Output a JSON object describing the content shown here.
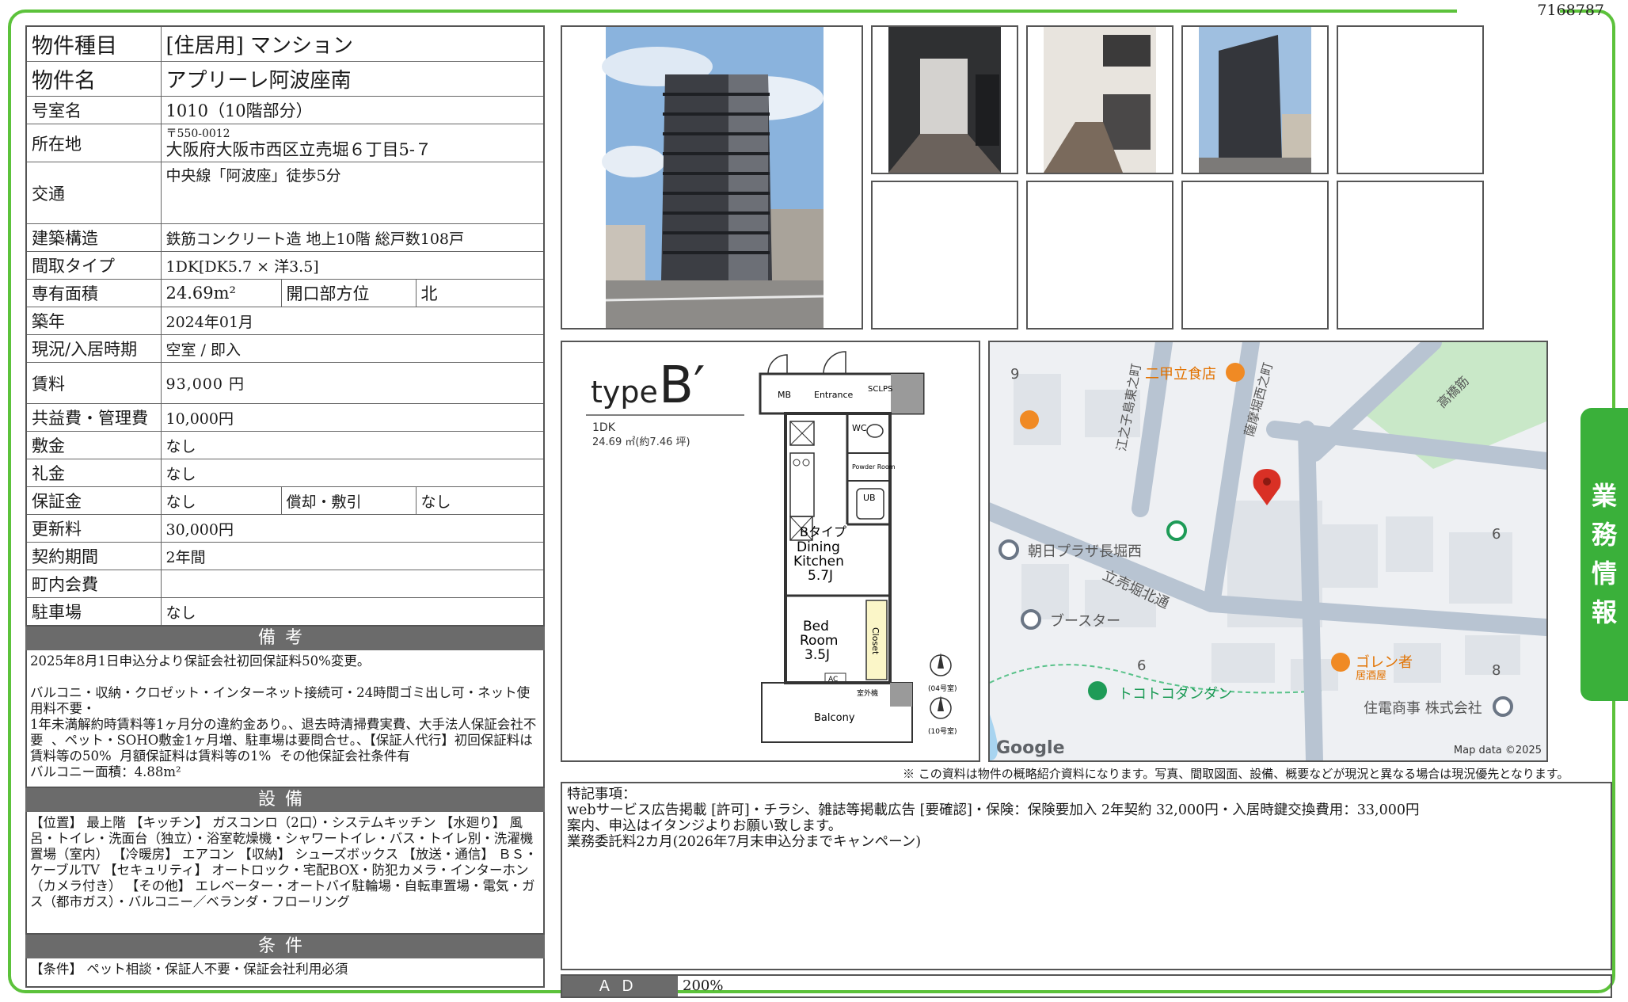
{
  "doc_id": "7168787",
  "side_tab": [
    "業",
    "務",
    "情",
    "報"
  ],
  "property": {
    "type_label": "物件種目",
    "type_value": "[住居用]  マンション",
    "name_label": "物件名",
    "name_value": "アプリーレ阿波座南",
    "room_label": "号室名",
    "room_value": "1010（10階部分）",
    "address_label": "所在地",
    "postal": "〒550-0012",
    "address": "大阪府大阪市西区立売堀６丁目5-７",
    "transport_label": "交通",
    "transport_value": "中央線「阿波座」徒歩5分",
    "structure_label": "建築構造",
    "structure_value": "鉄筋コンクリート造  地上10階  総戸数108戸",
    "layout_label": "間取タイプ",
    "layout_value": "1DK[DK5.7 × 洋3.5]",
    "area_label": "専有面積",
    "area_value": "24.69m²",
    "direction_label": "開口部方位",
    "direction_value": "北",
    "built_label": "築年",
    "built_value": "2024年01月",
    "status_label": "現況/入居時期",
    "status_value": "空室 /  即入",
    "rent_label": "賃料",
    "rent_value": "93,000 円",
    "fee_label": "共益費・管理費",
    "fee_value": "10,000円",
    "deposit_label": "敷金",
    "deposit_value": "なし",
    "key_money_label": "礼金",
    "key_money_value": "なし",
    "guarantee_label": "保証金",
    "guarantee_value": "なし",
    "amort_label": "償却・敷引",
    "amort_value": "なし",
    "renewal_label": "更新料",
    "renewal_value": "30,000円",
    "contract_label": "契約期間",
    "contract_value": "2年間",
    "town_fee_label": "町内会費",
    "town_fee_value": "",
    "parking_label": "駐車場",
    "parking_value": "なし"
  },
  "remarks_section": {
    "title": "備考",
    "text": "2025年8月1日申込分より保証会社初回保証料50%変更。\n\nバルコニ・収納・クロゼット・インターネット接続可・24時間ゴミ出し可・ネット使用料不要・\n1年未満解約時賃料等1ヶ月分の違約金あり。、退去時清掃費実費、大手法人保証会社不要  、ペット・SOHO敷金1ヶ月増、駐車場は要問合せ。、【保証人代行】初回保証料は賃料等の50%  月額保証料は賃料等の1%  その他保証会社条件有\nバルコニー面積：4.88m²"
  },
  "equipment_section": {
    "title": "設備",
    "text": "【位置】 最上階 【キッチン】 ガスコンロ（2口）・システムキッチン 【水廻り】 風呂・トイレ・洗面台（独立）・浴室乾燥機・シャワートイレ・バス・トイレ別・洗濯機置場（室内） 【冷暖房】 エアコン 【収納】 シューズボックス 【放送・通信】 ＢＳ・ケーブルTV 【セキュリティ】 オートロック・宅配BOX・防犯カメラ・インターホン（カメラ付き） 【その他】 エレベーター・オートバイ駐輪場・自転車置場・電気・ガス（都市ガス）・バルコニー／ベランダ・フローリング"
  },
  "conditions_section": {
    "title": "条件",
    "text": "【条件】 ペット相談・保証人不要・保証会社利用必須"
  },
  "floorplan": {
    "type_word": "type",
    "type_letter": "B′",
    "layout": "1DK",
    "area": "24.69  ㎡(約7.46 坪)",
    "mb": "MB",
    "entrance": "Entrance",
    "sdl": "SCL",
    "ps": "PS",
    "wc": "WC",
    "powder": "Powder Room",
    "ub": "UB",
    "dk_type": "Bタイプ",
    "dk_name1": "Dining",
    "dk_name2": "Kitchen",
    "dk_size": "5.7J",
    "bed1": "Bed",
    "bed2": "Room",
    "bed_size": "3.5J",
    "closet": "Closet",
    "ac": "AC",
    "outdoor": "室外機",
    "balcony": "Balcony",
    "floor_note1": "(04号室)",
    "floor_note2": "(10号室)"
  },
  "map": {
    "labels": {
      "restaurant": "二甲立食店",
      "plaza": "朝日プラザ長堀西",
      "street1": "立売堀北通",
      "booster": "ブースター",
      "park": "トコトコダンダン",
      "izakaya": "ゴレン者",
      "izakaya_sub": "居酒屋",
      "company": "住電商事 株式会社",
      "road_left": "江之子島東之町",
      "road_mid": "薩摩堀西之町",
      "road_right": "高橋筋",
      "block9": "9",
      "block6a": "6",
      "block6b": "6",
      "block8": "8"
    },
    "brand": "Google",
    "credit": "Map data ©2025"
  },
  "disclaimer": "※ この資料は物件の概略紹介資料になります。写真、間取図面、設備、概要などが現況と異なる場合は現況優先となります。",
  "special_notes": "特記事項：\nwebサービス広告掲載 [許可]・チラシ、雑誌等掲載広告 [要確認]・保険：保険要加入 2年契約 32,000円・入居時鍵交換費用：33,000円\n案内、申込はイタンジよりお願い致します。\n業務委託料2カ月(2026年7月末申込分までキャンペーン)",
  "ad": {
    "label": "ＡＤ",
    "value": "200%"
  },
  "colors": {
    "frame": "#5cc23b",
    "tab": "#3ab03a",
    "section_head": "#6b6b6b",
    "pin": "#d93025",
    "poi": "#f08a24"
  }
}
